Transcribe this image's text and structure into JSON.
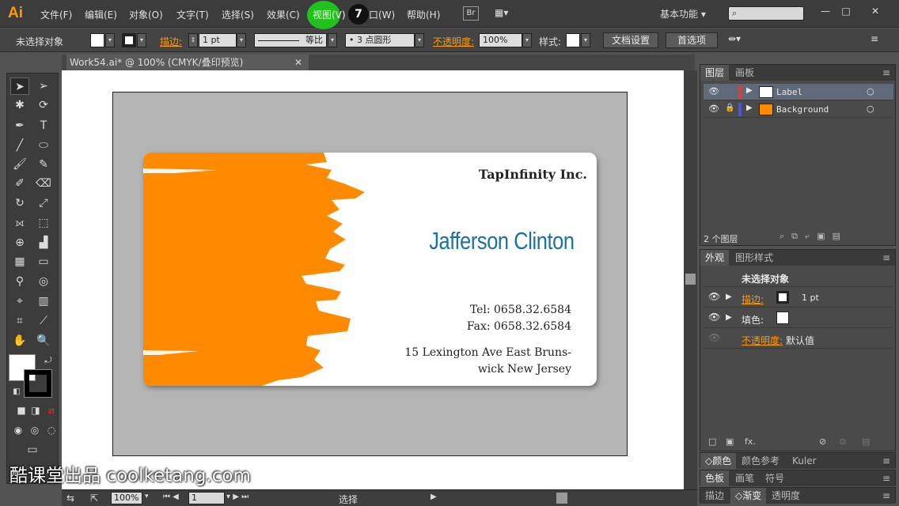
{
  "app": {
    "logo": "Ai",
    "menu": [
      "文件(F)",
      "编辑(E)",
      "对象(O)",
      "文字(T)",
      "选择(S)",
      "效果(C)",
      "视图(V)",
      "窗口(W)",
      "帮助(H)"
    ],
    "highlighted_menu_index": 6,
    "step_badge": "7",
    "bridge_label": "Br",
    "layout_label": "▦▾",
    "workspace": "基本功能",
    "window_buttons": [
      "—",
      "□",
      "✕"
    ]
  },
  "control_bar": {
    "selection_status": "未选择对象",
    "stroke_label": "描边:",
    "stroke_weight": "1 pt",
    "profile_label": "等比",
    "brush_label": "3 点圆形",
    "opacity_label": "不透明度:",
    "opacity_value": "100%",
    "style_label": "样式:",
    "doc_setup_button": "文档设置",
    "preferences_button": "首选项"
  },
  "document": {
    "tab_title": "Work54.ai* @ 100% (CMYK/叠印预览)",
    "close_glyph": "✕"
  },
  "card": {
    "company": "TapInfinity Inc.",
    "person_name": "Jafferson Clinton",
    "tel": "Tel:  0658.32.6584",
    "fax": "Fax:  0658.32.6584",
    "address": "15 Lexington Ave East Bruns-wick New Jersey",
    "brush_color": "#ff8a00",
    "name_color": "#1c6fa8"
  },
  "statusbar": {
    "zoom": "100%",
    "page": "1",
    "tool_status": "选择"
  },
  "layers_panel": {
    "tabs": [
      "图层",
      "画板"
    ],
    "layers": [
      {
        "name": "Label",
        "color": "#d84040",
        "selected": true
      },
      {
        "name": "Background",
        "color": "#5050d8",
        "selected": false
      }
    ],
    "count_label": "2 个图层"
  },
  "appearance_panel": {
    "tabs": [
      "外观",
      "图形样式"
    ],
    "header": "未选择对象",
    "stroke_label": "描边:",
    "stroke_value": "1 pt",
    "fill_label": "填色:",
    "opacity_label": "不透明度:",
    "opacity_value": "默认值",
    "fx_label": "fx."
  },
  "collapsed_panels": [
    [
      "颜色",
      "颜色参考",
      "Kuler"
    ],
    [
      "色板",
      "画笔",
      "符号"
    ],
    [
      "描边",
      "渐变",
      "透明度"
    ]
  ],
  "watermark": "酷课堂出品 coolketang.com"
}
